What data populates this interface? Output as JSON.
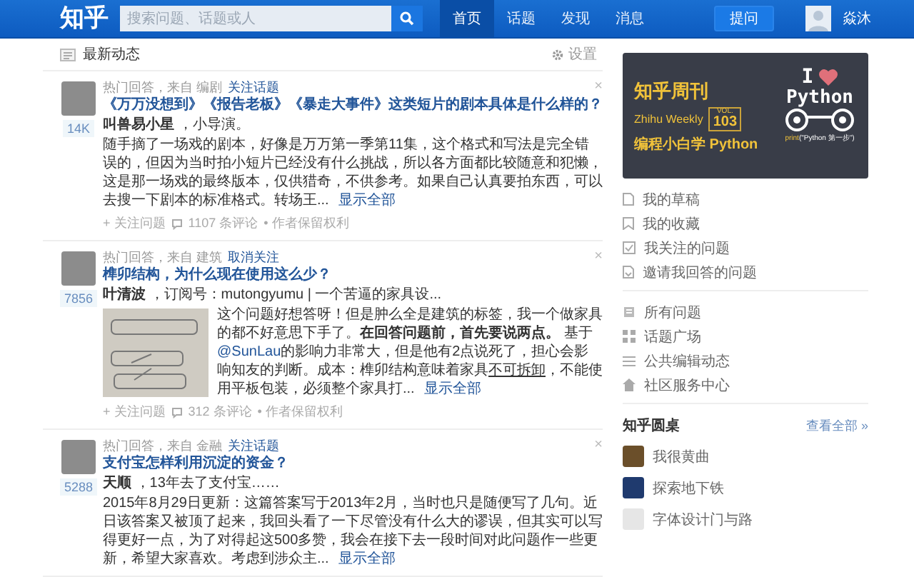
{
  "header": {
    "logo": "知乎",
    "search": {
      "placeholder": "搜索问题、话题或人"
    },
    "nav": [
      {
        "label": "首页",
        "selected": true
      },
      {
        "label": "话题",
        "selected": false
      },
      {
        "label": "发现",
        "selected": false
      },
      {
        "label": "消息",
        "selected": false
      }
    ],
    "ask_button": "提问",
    "user": {
      "name": "焱沐"
    }
  },
  "feed": {
    "title": "最新动态",
    "settings": "设置",
    "items": [
      {
        "source": "热门回答，来自 编剧",
        "topic_action": "关注话题",
        "title": "《万万没想到》《报告老板》《暴走大事件》这类短片的剧本具体是什么样的？",
        "votes": "14K",
        "close": "×",
        "author": "叫兽易小星",
        "bio": "，小导演。",
        "image": false,
        "body": [
          {
            "kind": "text",
            "text": "随手摘了一场戏的剧本，好像是万万第一季第11集，这个格式和写法是完全错误的，但因为当时拍小短片已经没有什么挑战，所以各方面都比较随意和犯懒，这是那一场戏的最终版本，仅供猎奇，不供参考。如果自己认真要拍东西，可以去搜一下剧本的标准格式。转场王..."
          }
        ],
        "more": "显示全部",
        "actions": {
          "follow": "+ 关注问题",
          "comments": "1107 条评论",
          "rights": "• 作者保留权利"
        }
      },
      {
        "source": "热门回答，来自 建筑",
        "topic_action": "取消关注",
        "title": "榫卯结构，为什么现在使用这么少？",
        "votes": "7856",
        "close": "×",
        "author": "叶清波",
        "bio": "，订阅号：mutongyumu | 一个苦逼的家具设...",
        "image": true,
        "body": [
          {
            "kind": "text",
            "text": "这个问题好想答呀！但是肿么全是建筑的标签，我一个做家具的都不好意思下手了。"
          },
          {
            "kind": "bold",
            "text": "在回答问题前，首先要说两点。"
          },
          {
            "kind": "text",
            "text": " 基于"
          },
          {
            "kind": "mention",
            "text": "@SunLau"
          },
          {
            "kind": "text",
            "text": "的影响力非常大，但是他有2点说死了，担心会影响知友的判断。成本：榫卯结构意味着家具"
          },
          {
            "kind": "underline",
            "text": "不可拆卸"
          },
          {
            "kind": "text",
            "text": "，不能使用平板包装，必须整个家具打..."
          }
        ],
        "more": "显示全部",
        "actions": {
          "follow": "+ 关注问题",
          "comments": "312 条评论",
          "rights": "• 作者保留权利"
        }
      },
      {
        "source": "热门回答，来自 金融",
        "topic_action": "关注话题",
        "title": "支付宝怎样利用沉淀的资金？",
        "votes": "5288",
        "close": "×",
        "author": "天顺",
        "bio": "，13年去了支付宝……",
        "image": false,
        "body": [
          {
            "kind": "text",
            "text": "2015年8月29日更新：这篇答案写于2013年2月，当时也只是随便写了几句。近日该答案又被顶了起来，我回头看了一下尽管没有什么大的谬误，但其实可以写得更好一点，为了对得起这500多赞，我会在接下去一段时间对此问题作一些更新，希望大家喜欢。考虑到涉众主..."
          }
        ],
        "more": "显示全部"
      }
    ]
  },
  "sidebar": {
    "banner": {
      "title": "知乎周刊",
      "subtitle": "Zhihu Weekly",
      "vol_label": "VOL.",
      "vol": "103",
      "tagline": "编程小白学 Python",
      "big_letter": "I",
      "big_word": "Python",
      "code_fn": "print",
      "code_arg": "(\"Python 第一步\")"
    },
    "links": [
      "我的草稿",
      "我的收藏",
      "我关注的问题",
      "邀请我回答的问题"
    ],
    "links_2": [
      "所有问题",
      "话题广场",
      "公共编辑动态",
      "社区服务中心"
    ],
    "roundtable": {
      "title": "知乎圆桌",
      "see_all": "查看全部 »",
      "items": [
        "我很黄曲",
        "探索地下铁",
        "字体设计门与路"
      ]
    }
  }
}
